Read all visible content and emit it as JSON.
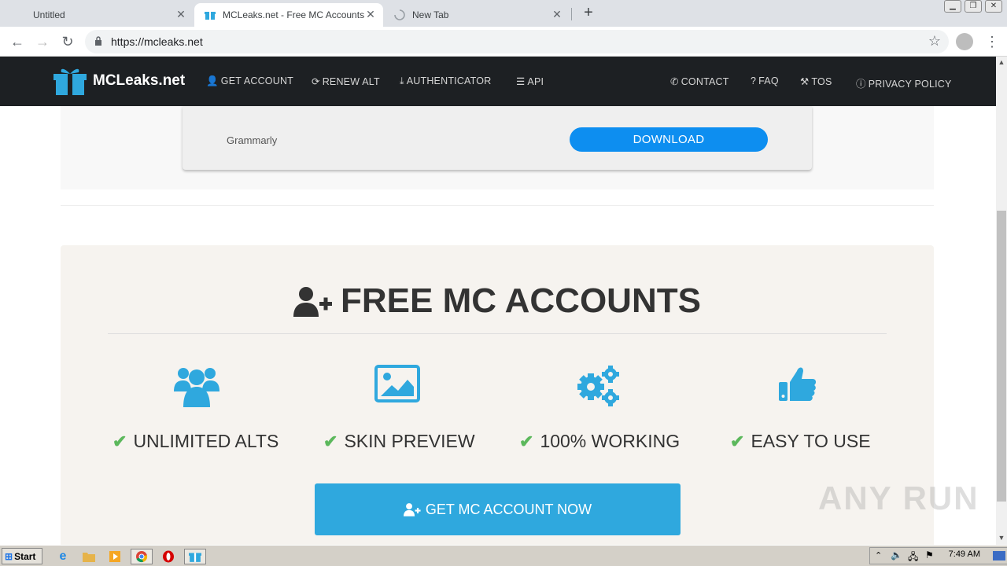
{
  "browser": {
    "tabs": [
      {
        "title": "Untitled",
        "active": false
      },
      {
        "title": "MCLeaks.net - Free MC Accounts",
        "active": true
      },
      {
        "title": "New Tab",
        "active": false
      }
    ],
    "url": "https://mcleaks.net"
  },
  "site": {
    "logo": "MCLeaks.net",
    "nav_left": [
      {
        "label": "GET ACCOUNT",
        "icon": "user-plus-icon"
      },
      {
        "label": "RENEW ALT",
        "icon": "refresh-icon"
      },
      {
        "label": "AUTHENTICATOR",
        "icon": "download-icon"
      },
      {
        "label": "API",
        "icon": "list-icon"
      }
    ],
    "nav_right": [
      {
        "label": "CONTACT",
        "icon": "phone-icon"
      },
      {
        "label": "FAQ",
        "icon": "question-icon"
      },
      {
        "label": "TOS",
        "icon": "gavel-icon"
      },
      {
        "label": "PRIVACY POLICY",
        "icon": "info-icon"
      }
    ]
  },
  "download": {
    "name": "Grammarly",
    "button": "DOWNLOAD"
  },
  "accounts": {
    "title": "FREE MC ACCOUNTS",
    "features": [
      {
        "label": "UNLIMITED ALTS",
        "icon": "users-icon"
      },
      {
        "label": "SKIN PREVIEW",
        "icon": "image-icon"
      },
      {
        "label": "100% WORKING",
        "icon": "gears-icon"
      },
      {
        "label": "EASY TO USE",
        "icon": "thumbs-up-icon"
      }
    ],
    "cta": "GET MC ACCOUNT NOW"
  },
  "watermark": "ANY RUN",
  "taskbar": {
    "start": "Start",
    "clock": "7:49 AM"
  },
  "colors": {
    "nav_bg": "#1d2023",
    "accent_blue": "#2fa8de",
    "download_blue": "#0d8ef0",
    "check_green": "#5cb85c"
  }
}
